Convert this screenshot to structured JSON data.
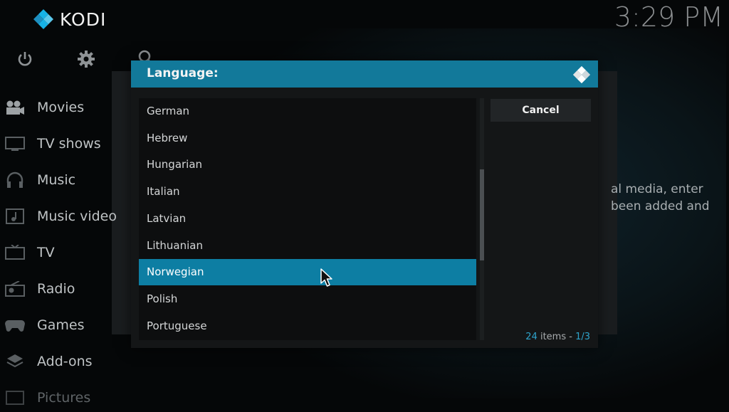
{
  "app": {
    "name": "KODI",
    "clock": "3:29 PM"
  },
  "top_icons": [
    "power-icon",
    "gear-icon",
    "search-icon"
  ],
  "sidebar": {
    "items": [
      {
        "label": "Movies",
        "icon": "movies-icon"
      },
      {
        "label": "TV shows",
        "icon": "tv-shows-icon"
      },
      {
        "label": "Music",
        "icon": "music-icon"
      },
      {
        "label": "Music video",
        "icon": "music-video-icon"
      },
      {
        "label": "TV",
        "icon": "tv-icon"
      },
      {
        "label": "Radio",
        "icon": "radio-icon"
      },
      {
        "label": "Games",
        "icon": "games-icon"
      },
      {
        "label": "Add-ons",
        "icon": "addons-icon"
      },
      {
        "label": "Pictures",
        "icon": "pictures-icon"
      }
    ]
  },
  "background_text": {
    "line1": "al media, enter",
    "line2": "been added and"
  },
  "dialog": {
    "title": "Language:",
    "items": [
      {
        "label": "German",
        "selected": false
      },
      {
        "label": "Hebrew",
        "selected": false
      },
      {
        "label": "Hungarian",
        "selected": false
      },
      {
        "label": "Italian",
        "selected": false
      },
      {
        "label": "Latvian",
        "selected": false
      },
      {
        "label": "Lithuanian",
        "selected": false
      },
      {
        "label": "Norwegian",
        "selected": true
      },
      {
        "label": "Polish",
        "selected": false
      },
      {
        "label": "Portuguese",
        "selected": false
      }
    ],
    "cancel_label": "Cancel",
    "count_number": "24",
    "count_text": " items - ",
    "page_text": "1/3"
  },
  "colors": {
    "accent": "#12799a",
    "selected": "#0d7ea3",
    "count_highlight": "#2ea4cc"
  }
}
